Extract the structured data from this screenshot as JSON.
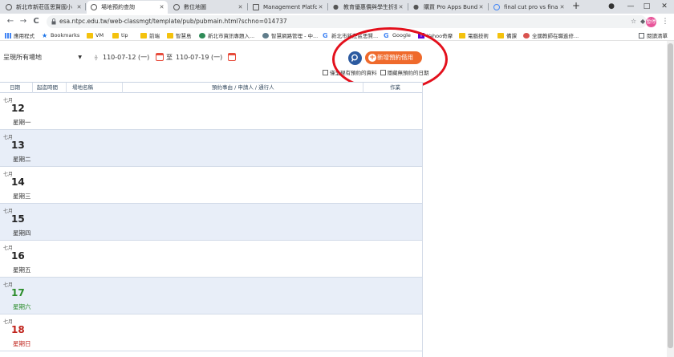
{
  "browser": {
    "tabs": [
      {
        "title": "新北市新莊區思賢國小"
      },
      {
        "title": "場地預約查詢"
      },
      {
        "title": "數位地圖"
      },
      {
        "title": "Management Platform"
      },
      {
        "title": "教育優惠價與學生折扣"
      },
      {
        "title": "購買 Pro Apps Bundle"
      },
      {
        "title": "final cut pro vs final cu"
      }
    ],
    "new_tab": "+",
    "window_buttons": {
      "minimize": "—",
      "maximize": "□",
      "close": "✕"
    },
    "nav": {
      "back": "←",
      "forward": "→",
      "reload": "C"
    },
    "url": "esa.ntpc.edu.tw/web-classmgt/template/pub/pubmain.html?schno=014737",
    "profile": "暫停",
    "reading_list": "閱讀清單",
    "bookmarks": [
      {
        "label": "應用程式",
        "icon": "apps-grid-icon"
      },
      {
        "label": "Bookmarks",
        "icon": "star-icon"
      },
      {
        "label": "VM",
        "icon": "folder-icon"
      },
      {
        "label": "tip",
        "icon": "folder-icon"
      },
      {
        "label": "前端",
        "icon": "folder-icon"
      },
      {
        "label": "智慧島",
        "icon": "folder-icon"
      },
      {
        "label": "新北市資訊專題入...",
        "icon": "site-icon"
      },
      {
        "label": "智慧網路管理 - 中...",
        "icon": "site-icon"
      },
      {
        "label": "新北市新莊區思賢...",
        "icon": "google-icon"
      },
      {
        "label": "Google",
        "icon": "google-icon"
      },
      {
        "label": "Yahoo奇摩",
        "icon": "yahoo-icon"
      },
      {
        "label": "電腦技術",
        "icon": "folder-icon"
      },
      {
        "label": "備課",
        "icon": "folder-icon"
      },
      {
        "label": "全國教師在職進修...",
        "icon": "site-icon"
      }
    ]
  },
  "filters": {
    "place": "呈現所有場地",
    "date_from": "110-07-12 (一)",
    "to_label": "至",
    "date_to": "110-07-19 (一)",
    "add_button": "新增預約借用",
    "show_unreserved": "僅呈現有預約的資料",
    "hide_empty": "隱藏無預約的日期"
  },
  "table": {
    "headers": {
      "date": "日期",
      "period": "起迄時間",
      "venue": "場地名稱",
      "reason": "預約事由 / 申請人 / 通行人",
      "action": "作業"
    },
    "rows": [
      {
        "month": "七月",
        "day": "12",
        "weekday": "星期一"
      },
      {
        "month": "七月",
        "day": "13",
        "weekday": "星期二"
      },
      {
        "month": "七月",
        "day": "14",
        "weekday": "星期三"
      },
      {
        "month": "七月",
        "day": "15",
        "weekday": "星期四"
      },
      {
        "month": "七月",
        "day": "16",
        "weekday": "星期五"
      },
      {
        "month": "七月",
        "day": "17",
        "weekday": "星期六"
      },
      {
        "month": "七月",
        "day": "18",
        "weekday": "星期日"
      }
    ]
  },
  "colors": {
    "accent_orange": "#ef6a2c",
    "search_blue": "#2c5aa0",
    "highlight_red": "#e3101c",
    "saturday_green": "#2a8c2a",
    "sunday_red": "#c0241c"
  }
}
